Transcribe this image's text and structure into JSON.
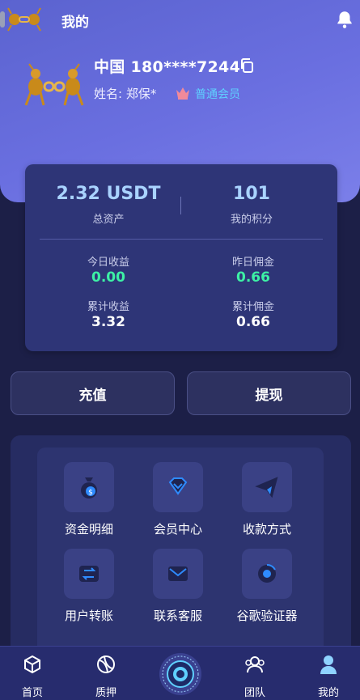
{
  "header": {
    "title": "我的"
  },
  "profile": {
    "phone": "中国 180****7244",
    "name": "姓名: 郑保*",
    "member_level": "普通会员"
  },
  "assets": {
    "total_value": "2.32 USDT",
    "total_label": "总资产",
    "points_value": "101",
    "points_label": "我的积分",
    "today_income_label": "今日收益",
    "today_income_value": "0.00",
    "yesterday_commission_label": "昨日佣金",
    "yesterday_commission_value": "0.66",
    "total_income_label": "累计收益",
    "total_income_value": "3.32",
    "total_commission_label": "累计佣金",
    "total_commission_value": "0.66"
  },
  "actions": {
    "recharge": "充值",
    "withdraw": "提现"
  },
  "menu": {
    "items": [
      {
        "label": "资金明细",
        "icon": "money-bag-icon"
      },
      {
        "label": "会员中心",
        "icon": "diamond-icon"
      },
      {
        "label": "收款方式",
        "icon": "paper-plane-icon"
      },
      {
        "label": "用户转账",
        "icon": "transfer-icon"
      },
      {
        "label": "联系客服",
        "icon": "mail-icon"
      },
      {
        "label": "谷歌验证器",
        "icon": "google-icon"
      }
    ]
  },
  "nav": {
    "items": [
      {
        "label": "首页",
        "icon": "cube-icon"
      },
      {
        "label": "质押",
        "icon": "ball-icon"
      },
      {
        "label": "团队",
        "icon": "team-icon"
      },
      {
        "label": "我的",
        "icon": "user-icon"
      }
    ],
    "active": "我的"
  },
  "colors": {
    "accent": "#5fd0ff",
    "income": "#3df0a5",
    "hero": "#6a6fe0",
    "background": "#1c1f47"
  }
}
